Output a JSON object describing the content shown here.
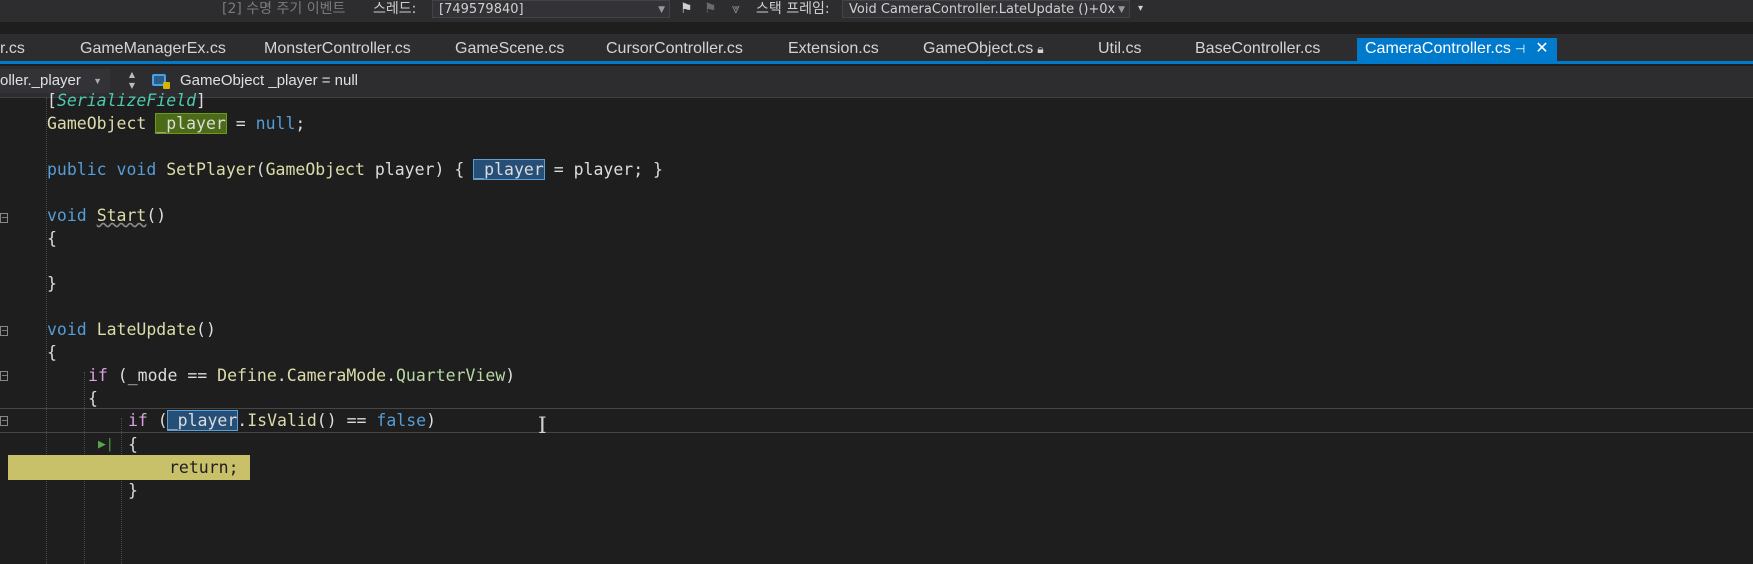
{
  "toolbar": {
    "process_box": "[2] 수명 주기 이벤트",
    "thread_label": "스레드:",
    "thread_value": "[749579840]",
    "stackframe_label": "스택 프레임:",
    "stackframe_value": "Void CameraController.LateUpdate ()+0x"
  },
  "tabs": [
    {
      "label": "r.cs"
    },
    {
      "label": "GameManagerEx.cs"
    },
    {
      "label": "MonsterController.cs"
    },
    {
      "label": "GameScene.cs"
    },
    {
      "label": "CursorController.cs"
    },
    {
      "label": "Extension.cs"
    },
    {
      "label": "GameObject.cs"
    },
    {
      "label": "Util.cs"
    },
    {
      "label": "BaseController.cs"
    },
    {
      "label": "CameraController.cs",
      "active": true
    }
  ],
  "navbar": {
    "member_dropdown": "oller._player",
    "member_detail": "GameObject _player = null"
  },
  "code": {
    "l1_attr": "SerializeField",
    "l2_type": "GameObject",
    "l2_field": "_player",
    "l2_rest": "null",
    "l3_public": "public",
    "l3_void": "void",
    "l3_method": "SetPlayer",
    "l3_paramtype": "GameObject",
    "l3_param": "player",
    "l3_field": "_player",
    "l3_assign": "player",
    "l4_void": "void",
    "l4_method": "Start",
    "l5_void": "void",
    "l5_method": "LateUpdate",
    "l6_if": "if",
    "l6_mode": "_mode",
    "l6_define": "Define",
    "l6_enum": "CameraMode",
    "l6_value": "QuarterView",
    "l7_if": "if",
    "l7_field": "_player",
    "l7_method": "IsValid",
    "l7_false": "false",
    "l8_return": "return;"
  }
}
